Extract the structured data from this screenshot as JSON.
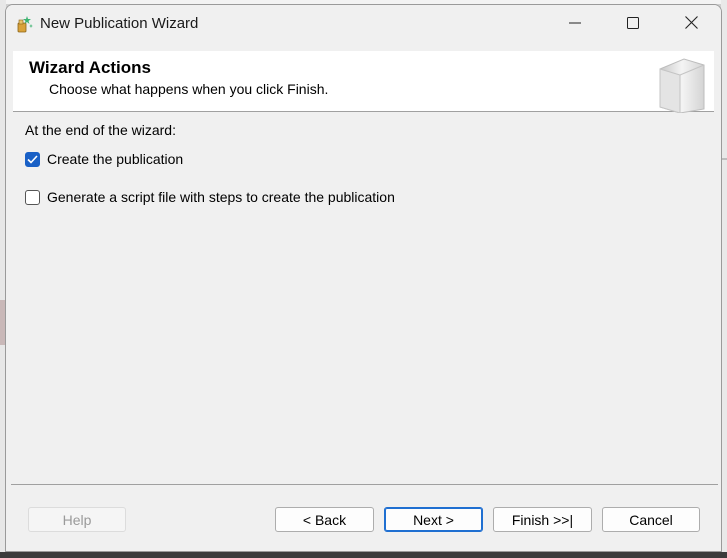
{
  "window": {
    "title": "New Publication Wizard"
  },
  "header": {
    "title": "Wizard Actions",
    "subtitle": "Choose what happens when you click Finish."
  },
  "body": {
    "label": "At the end of the wizard:",
    "options": [
      {
        "label": "Create the publication",
        "checked": true
      },
      {
        "label": "Generate a script file with steps to create the publication",
        "checked": false
      }
    ]
  },
  "buttons": {
    "help": "Help",
    "back": "< Back",
    "next": "Next >",
    "finish": "Finish >>|",
    "cancel": "Cancel"
  },
  "icons": [
    "app-icon",
    "minimize-icon",
    "maximize-icon",
    "close-icon",
    "wizard-book-icon",
    "checkmark-icon"
  ],
  "colors": {
    "accent": "#1960c6"
  }
}
